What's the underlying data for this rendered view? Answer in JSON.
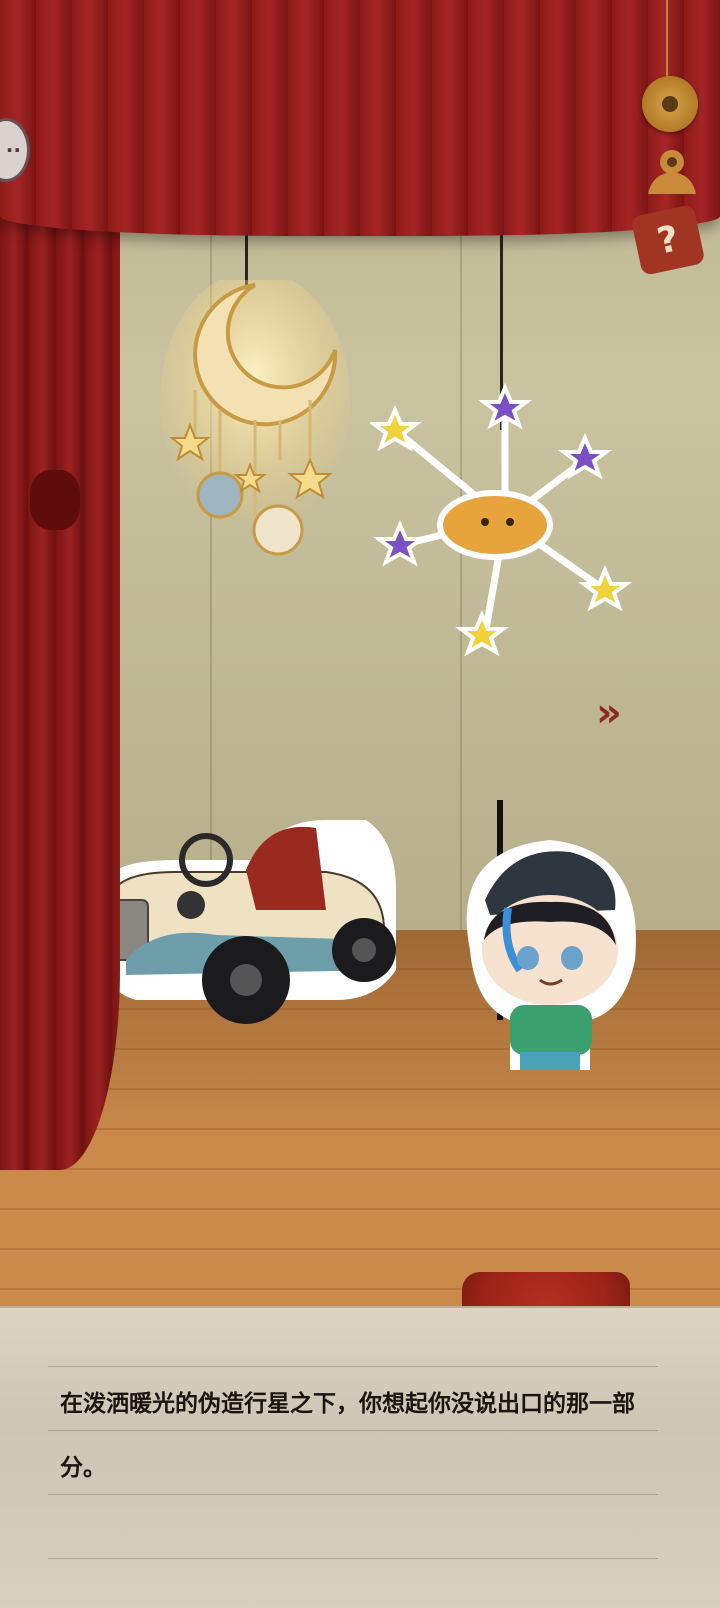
{
  "hud": {
    "hint_button_icon": "speech-bubble-icon",
    "coin_icon": "coin-icon",
    "character_icon": "character-icon",
    "help_icon": "help-question-icon",
    "help_glyph": "?",
    "next_icon": "chevron-right-icon"
  },
  "scene": {
    "props": [
      "crescent-moon-mobile",
      "star-cloud-mobile",
      "toy-car",
      "boy-character-cutout"
    ]
  },
  "dialog": {
    "text": "在泼洒暖光的伪造行星之下，你想起你没说出口的那一部分。"
  }
}
